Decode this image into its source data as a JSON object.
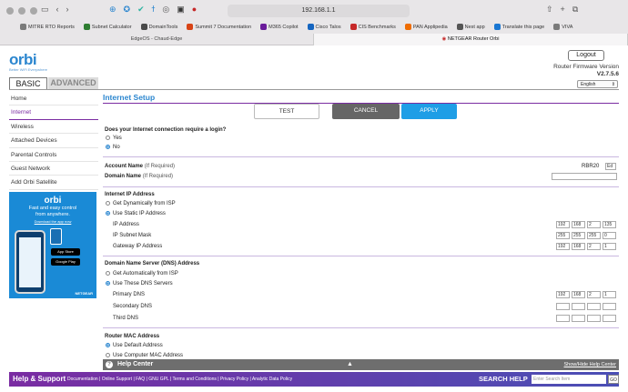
{
  "browser": {
    "url": "192.168.1.1",
    "bookmarks": [
      {
        "label": "MITRE RTO Reports",
        "icon": "folder-icon",
        "color": "#7a7a7a"
      },
      {
        "label": "Subnet Calculator",
        "icon": "calculator-icon",
        "color": "#2e7d32"
      },
      {
        "label": "DomainTools",
        "icon": "domaintools-icon",
        "color": "#4a4a4a"
      },
      {
        "label": "Summit 7 Documentation",
        "icon": "summit7-icon",
        "color": "#d84315"
      },
      {
        "label": "M365 Copilot",
        "icon": "copilot-icon",
        "color": "#6a1b9a"
      },
      {
        "label": "Cisco Talos",
        "icon": "talos-icon",
        "color": "#1565c0"
      },
      {
        "label": "CIS Benchmarks",
        "icon": "cis-icon",
        "color": "#c62828"
      },
      {
        "label": "PAN Applipedia",
        "icon": "pan-icon",
        "color": "#ef6c00"
      },
      {
        "label": "Nest app",
        "icon": "nest-icon",
        "color": "#555555"
      },
      {
        "label": "Translate this page",
        "icon": "translate-icon",
        "color": "#1976d2"
      },
      {
        "label": "VIVA",
        "icon": "folder-icon",
        "color": "#7a7a7a"
      }
    ],
    "tabs": [
      {
        "label": "EdgeOS - Chaud-Edge",
        "active": false
      },
      {
        "label": "NETGEAR Router Orbi",
        "active": true
      }
    ]
  },
  "header": {
    "logo": "orbi",
    "tagline": "Better WiFi Everywhere",
    "logout_label": "Logout",
    "firmware_label": "Router Firmware Version",
    "firmware_version": "V2.7.5.6",
    "language": "English"
  },
  "top_tabs": {
    "basic": "BASIC",
    "advanced": "ADVANCED"
  },
  "sidebar": {
    "items": [
      {
        "label": "Home"
      },
      {
        "label": "Internet"
      },
      {
        "label": "Wireless"
      },
      {
        "label": "Attached Devices"
      },
      {
        "label": "Parental Controls"
      },
      {
        "label": "Guest Network"
      },
      {
        "label": "Add Orbi Satellite"
      }
    ],
    "active_index": 1
  },
  "ad": {
    "logo": "orbi",
    "line1": "Fast and easy control",
    "line2": "from anywhere.",
    "link": "Download the app now",
    "app_store": "App Store",
    "google_play": "Google Play",
    "brand": "NETGEAR"
  },
  "main": {
    "title": "Internet Setup",
    "buttons": {
      "test": "TEST",
      "cancel": "CANCEL",
      "apply": "APPLY"
    },
    "login_question": "Does your Internet connection require a login?",
    "login_yes": "Yes",
    "login_no": "No",
    "account_name_label": "Account Name",
    "account_name_hint": "(If Required)",
    "account_name_value": "RBR20",
    "account_edit_label": "Ed",
    "domain_name_label": "Domain Name",
    "domain_name_hint": "(If Required)",
    "internet_ip_heading": "Internet IP Address",
    "ip_dynamic": "Get Dynamically from ISP",
    "ip_static": "Use Static IP Address",
    "ip_address_label": "IP Address",
    "ip_address": [
      "192",
      "168",
      "2",
      "135"
    ],
    "subnet_label": "IP Subnet Mask",
    "subnet": [
      "255",
      "255",
      "255",
      "0"
    ],
    "gateway_label": "Gateway IP Address",
    "gateway": [
      "192",
      "168",
      "2",
      "1"
    ],
    "dns_heading": "Domain Name Server (DNS) Address",
    "dns_auto": "Get Automatically from ISP",
    "dns_manual": "Use These DNS Servers",
    "primary_dns_label": "Primary DNS",
    "primary_dns": [
      "192",
      "168",
      "2",
      "1"
    ],
    "secondary_dns_label": "Secondary DNS",
    "third_dns_label": "Third DNS",
    "mac_heading": "Router MAC Address",
    "mac_default": "Use Default Address",
    "mac_computer": "Use Computer MAC Address"
  },
  "help_center": {
    "label": "Help Center",
    "toggle": "Show/Hide Help Center"
  },
  "footer": {
    "title": "Help & Support",
    "links": "Documentation | Online Support | FAQ | GNU GPL | Terms and Conditions | Privacy Policy | Analytic Data Policy",
    "search_label": "SEARCH HELP",
    "search_placeholder": "Enter Search Item",
    "go_label": "GO"
  }
}
